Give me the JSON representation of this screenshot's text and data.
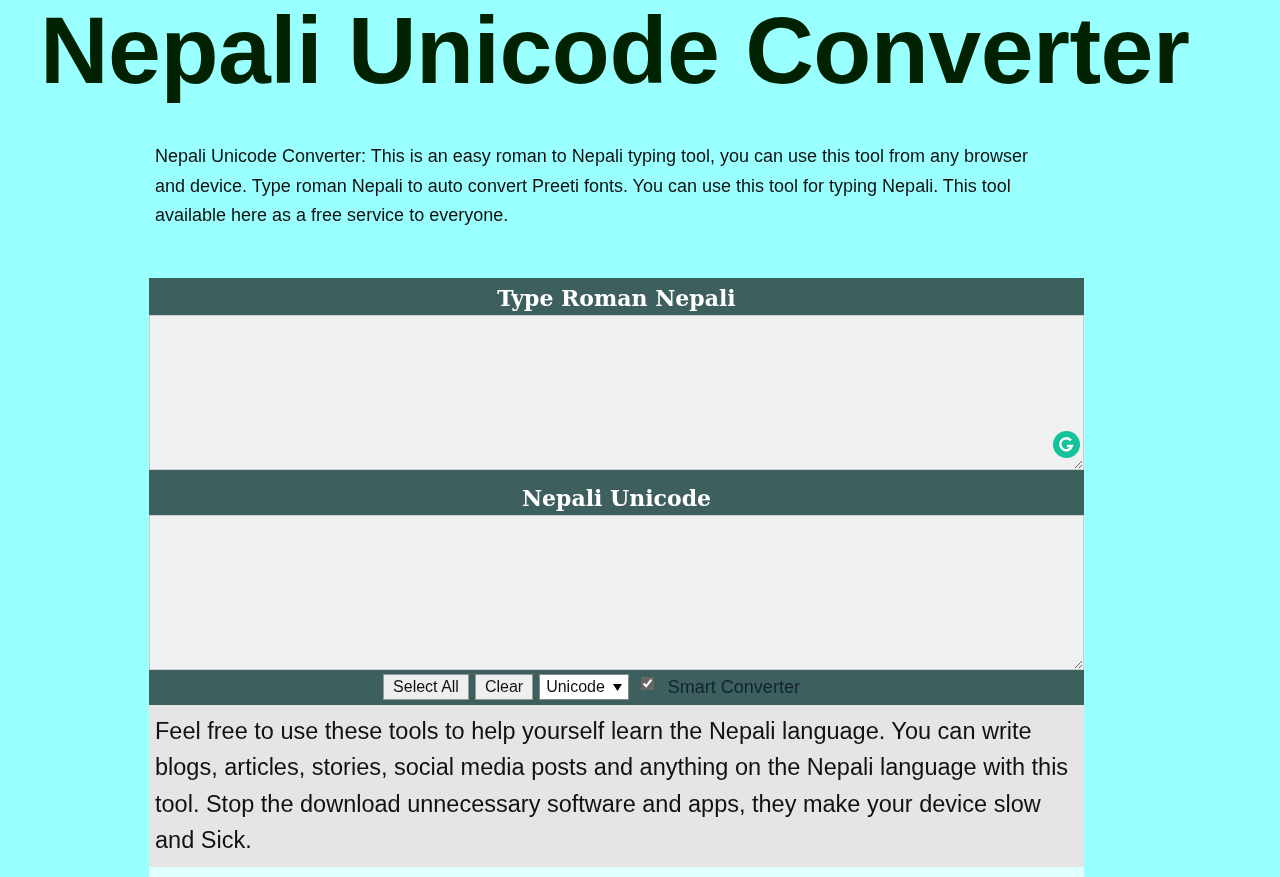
{
  "title": "Nepali Unicode Converter",
  "intro": "Nepali Unicode Converter: This is an easy roman to Nepali typing tool, you can use this tool from any browser and device. Type roman Nepali to auto convert Preeti fonts. You can use this tool for typing Nepali. This tool available here as a free service to everyone.",
  "input_panel": {
    "heading": "Type Roman Nepali"
  },
  "output_panel": {
    "heading": "Nepali Unicode"
  },
  "toolbar": {
    "buttons": [
      "Select All",
      "Clear"
    ],
    "font_select": "Unicode",
    "smart_converter": {
      "label": "Smart Converter",
      "checked": true
    }
  },
  "footer_text": "Feel free to use these tools to help yourself learn the Nepali language. You can write blogs, articles, stories, social media posts and anything on the Nepali language with this tool. Stop the download unnecessary software and apps, they make your device slow and Sick."
}
